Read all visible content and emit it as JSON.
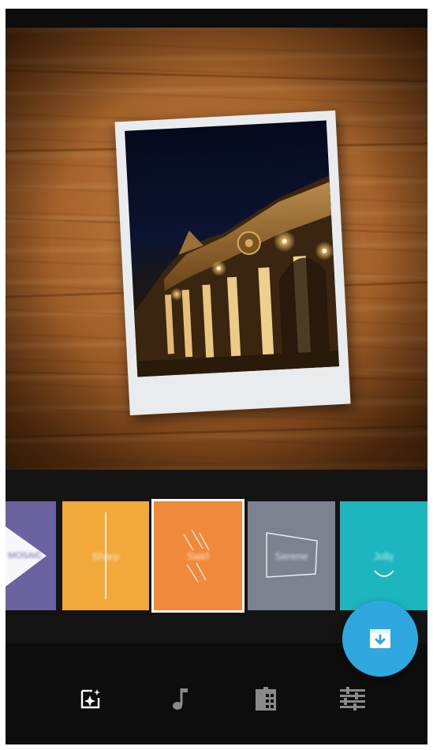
{
  "screen": {
    "title": ""
  },
  "filters": [
    {
      "name": "MOSAIC_partial",
      "label": "MOSAIC",
      "color": "#6b63a0"
    },
    {
      "name": "sharp",
      "label": "Sharp",
      "color": "#f2a93a"
    },
    {
      "name": "swirl",
      "label": "Swirl",
      "color": "#f0893a",
      "selected": true
    },
    {
      "name": "serene",
      "label": "Serene",
      "color": "#7d8290"
    },
    {
      "name": "jolly",
      "label": "Jolly",
      "color": "#1db5be"
    }
  ],
  "fab": {
    "icon": "download-box-icon",
    "color": "#2fa8e0"
  },
  "toolbar": {
    "items": [
      {
        "icon": "theme-sparkle-icon",
        "active": true
      },
      {
        "icon": "music-note-icon",
        "active": false
      },
      {
        "icon": "film-clip-icon",
        "active": false
      },
      {
        "icon": "adjust-sliders-icon",
        "active": false
      }
    ]
  }
}
